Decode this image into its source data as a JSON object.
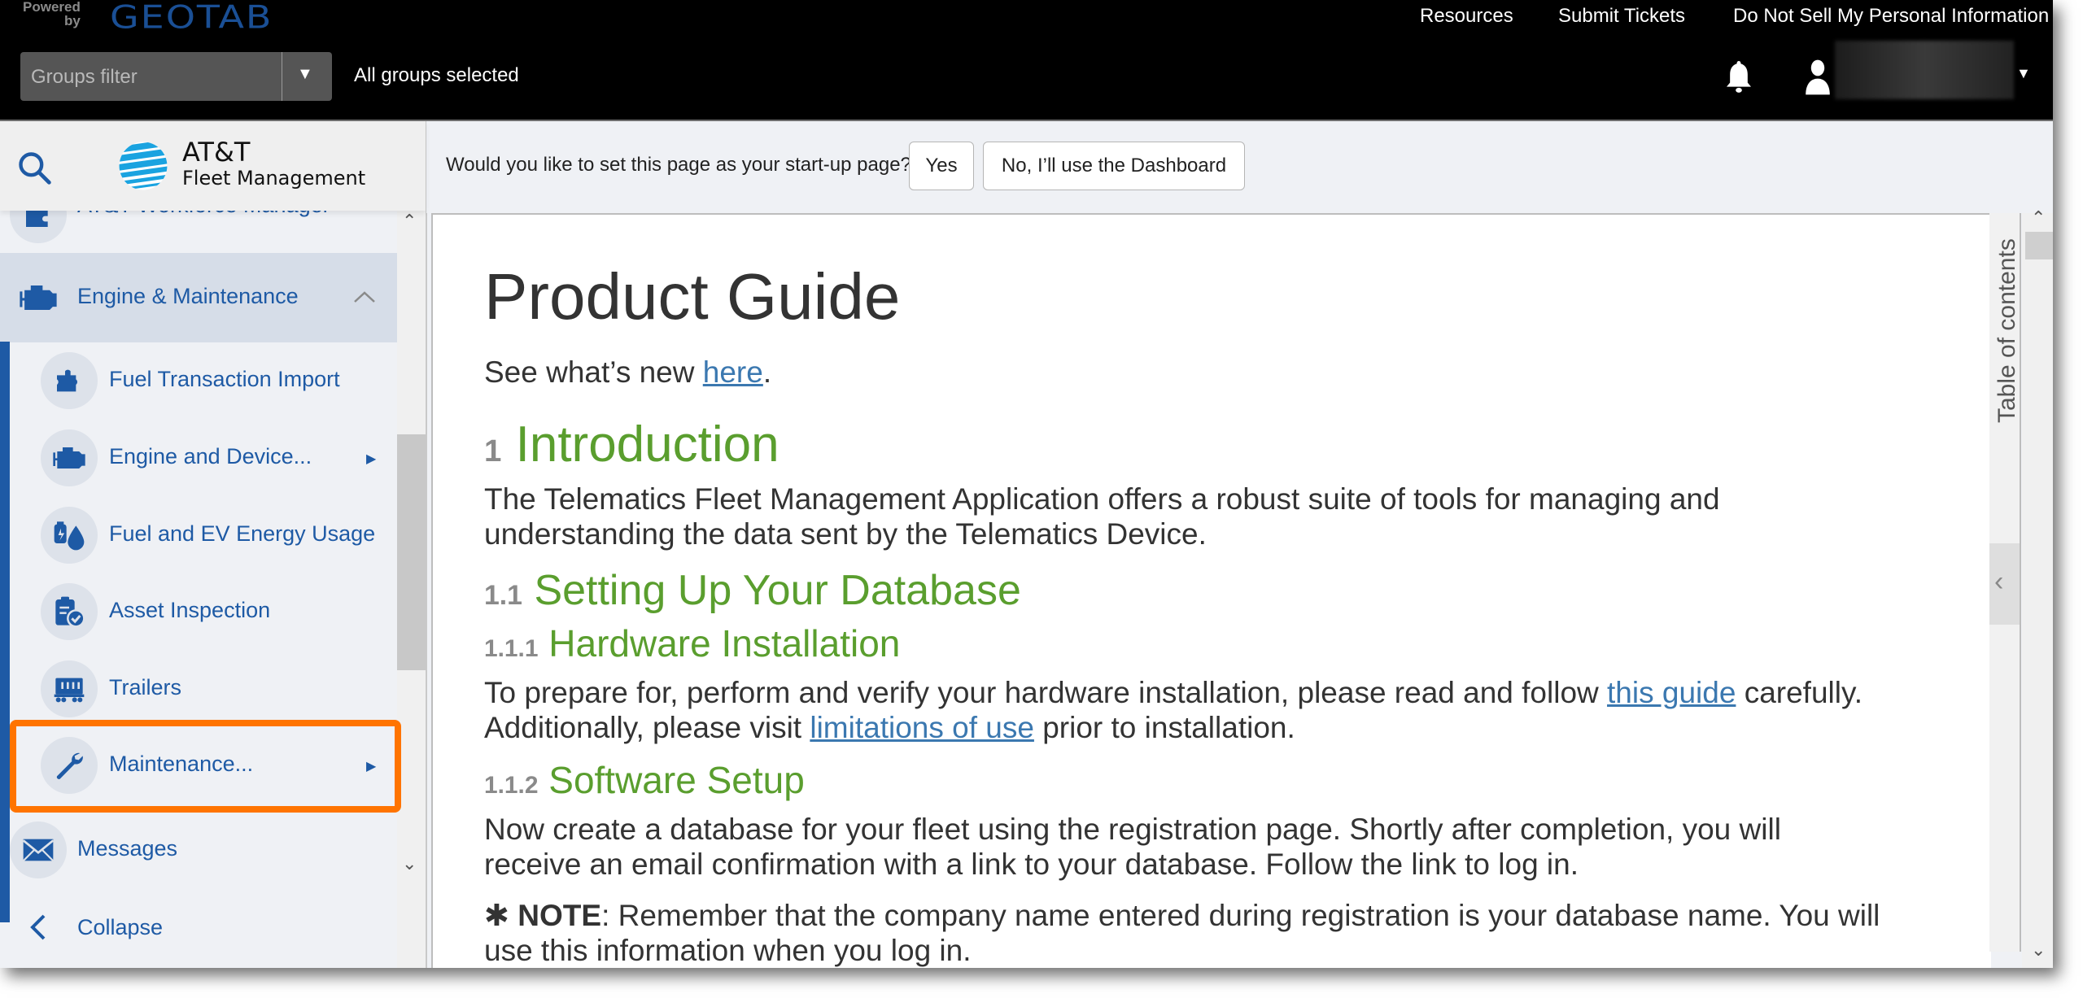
{
  "header": {
    "powered_by": "Powered\nby",
    "brand": "GEOTAB",
    "groups_filter_placeholder": "Groups filter",
    "groups_status": "All groups selected",
    "links": [
      "Resources",
      "Submit Tickets",
      "Do Not Sell My Personal Information"
    ],
    "icons": [
      "bell-icon",
      "user-icon",
      "chevron-down-icon"
    ]
  },
  "sidebar": {
    "brand_name": "AT&T",
    "brand_sub": "Fleet Management",
    "partial_item": "AT&T Workforce Manager",
    "section": {
      "label": "Engine & Maintenance",
      "expanded": true
    },
    "items": [
      {
        "label": "Fuel Transaction Import",
        "icon": "puzzle-icon",
        "submenu": false
      },
      {
        "label": "Engine and Device...",
        "icon": "engine-icon",
        "submenu": true
      },
      {
        "label": "Fuel and EV Energy Usage",
        "icon": "fuel-ev-icon",
        "submenu": false
      },
      {
        "label": "Asset Inspection",
        "icon": "clipboard-check-icon",
        "submenu": false
      },
      {
        "label": "Trailers",
        "icon": "trailer-icon",
        "submenu": false
      },
      {
        "label": "Maintenance...",
        "icon": "wrench-icon",
        "submenu": true,
        "highlighted": true
      }
    ],
    "messages": "Messages",
    "collapse": "Collapse"
  },
  "startup": {
    "question": "Would you like to set this page as your start-up page?",
    "yes": "Yes",
    "no": "No, I’ll use the Dashboard"
  },
  "doc": {
    "title": "Product Guide",
    "whats_new_prefix": "See what’s new ",
    "whats_new_link": "here",
    "whats_new_suffix": ".",
    "s1_num": "1",
    "s1_title": "Introduction",
    "s1_body_1": "The Telematics Fleet Management Application offers a robust suite of tools for managing and",
    "s1_body_2": "understanding the data sent by the Telematics Device.",
    "s11_num": "1.1",
    "s11_title": "Setting Up Your Database",
    "s111_num": "1.1.1",
    "s111_title": "Hardware Installation",
    "s111_body_1_prefix": "To prepare for, perform and verify your hardware installation, please read and follow ",
    "s111_body_1_link": "this guide",
    "s111_body_1_suffix": " carefully.",
    "s111_body_2_prefix": "Additionally, please visit ",
    "s111_body_2_link": "limitations of use",
    "s111_body_2_suffix": " prior to installation.",
    "s112_num": "1.1.2",
    "s112_title": "Software Setup",
    "s112_body_1": "Now create a database for your fleet using the registration page. Shortly after completion, you will",
    "s112_body_2": "receive an email confirmation with a link to your database. Follow the link to log in.",
    "note_star": "✱ ",
    "note_label": "NOTE",
    "note_body_1": ": Remember that the company name entered during registration is your database name. You will",
    "note_body_2": "use this information when you log in."
  },
  "toc": {
    "label": "Table of contents"
  },
  "colors": {
    "accent_blue": "#1e5aa5",
    "heading_green": "#5a9e2e",
    "link_blue": "#3b78b0",
    "highlight_orange": "#ff7400"
  }
}
